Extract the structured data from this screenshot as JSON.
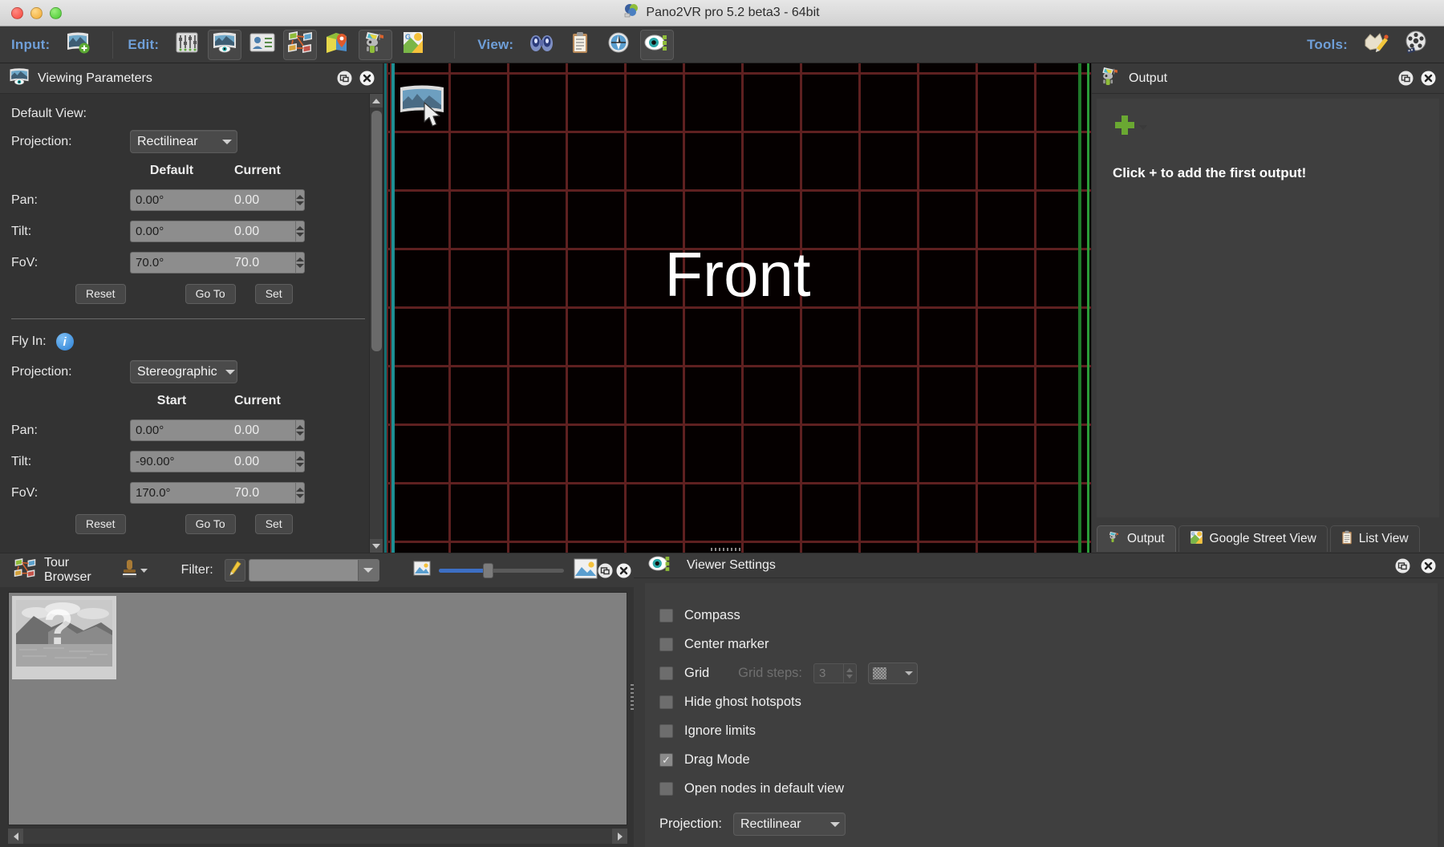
{
  "window": {
    "title": "Pano2VR pro 5.2 beta3 - 64bit",
    "app_icon": "pano2vr-logo-icon",
    "traffic_lights": [
      "close-button",
      "minimize-button",
      "zoom-button"
    ]
  },
  "toolbar": {
    "input_label": "Input:",
    "edit_label": "Edit:",
    "view_label": "View:",
    "tools_label": "Tools:",
    "input_buttons": [
      {
        "name": "add-input-panorama-button",
        "icon": "panorama-plus-icon",
        "active": false
      }
    ],
    "edit_buttons": [
      {
        "name": "edit-sliders-button",
        "icon": "sliders-icon",
        "active": false
      },
      {
        "name": "edit-viewing-parameters-button",
        "icon": "panorama-eye-icon",
        "active": true
      },
      {
        "name": "edit-user-data-button",
        "icon": "id-card-icon",
        "active": false
      },
      {
        "name": "edit-tour-browser-button",
        "icon": "tour-nodes-icon",
        "active": true
      },
      {
        "name": "edit-hotspots-button",
        "icon": "map-pin-icon",
        "active": false
      },
      {
        "name": "edit-output-button",
        "icon": "output-robot-icon",
        "active": true
      },
      {
        "name": "edit-google-street-view-button",
        "icon": "google-maps-icon",
        "active": false
      }
    ],
    "view_buttons": [
      {
        "name": "view-binoculars-button",
        "icon": "binoculars-icon",
        "active": false
      },
      {
        "name": "view-list-button",
        "icon": "clipboard-icon",
        "active": false
      },
      {
        "name": "view-compass-button",
        "icon": "compass-icon",
        "active": false
      },
      {
        "name": "view-viewer-settings-button",
        "icon": "eye-settings-icon",
        "active": true
      }
    ],
    "tools_buttons": [
      {
        "name": "tools-skin-editor-button",
        "icon": "skin-pencil-icon",
        "active": false
      },
      {
        "name": "tools-animation-editor-button",
        "icon": "film-reel-icon",
        "active": false
      }
    ]
  },
  "viewing_parameters": {
    "panel_title": "Viewing Parameters",
    "panel_icon": "panorama-eye-icon",
    "undock_icon": "undock-icon",
    "close_icon": "close-icon",
    "default_view": {
      "section_label": "Default View:",
      "projection_label": "Projection:",
      "projection_value": "Rectilinear",
      "col_value_header": "Default",
      "col_current_header": "Current",
      "rows": [
        {
          "label": "Pan:",
          "value": "0.00°",
          "current": "0.00"
        },
        {
          "label": "Tilt:",
          "value": "0.00°",
          "current": "0.00"
        },
        {
          "label": "FoV:",
          "value": "70.0°",
          "current": "70.0"
        }
      ],
      "reset_label": "Reset",
      "goto_label": "Go To",
      "set_label": "Set"
    },
    "fly_in": {
      "section_label": "Fly In:",
      "info_icon": "info-icon",
      "projection_label": "Projection:",
      "projection_value": "Stereographic",
      "col_value_header": "Start",
      "col_current_header": "Current",
      "rows": [
        {
          "label": "Pan:",
          "value": "0.00°",
          "current": "0.00"
        },
        {
          "label": "Tilt:",
          "value": "-90.00°",
          "current": "0.00"
        },
        {
          "label": "FoV:",
          "value": "170.0°",
          "current": "70.0"
        }
      ],
      "reset_label": "Reset",
      "goto_label": "Go To",
      "set_label": "Set"
    }
  },
  "viewport": {
    "face_label": "Front",
    "grid_color": "#5a1f1f",
    "background_color": "#050000",
    "left_edge_color": "#1e8f93",
    "right_edge_color": "#2a9c39",
    "pano_thumb_icon": "panorama-thumbnail-icon",
    "cursor_icon": "arrow-cursor-icon"
  },
  "output": {
    "panel_title": "Output",
    "panel_icon": "output-robot-icon",
    "undock_icon": "undock-icon",
    "close_icon": "close-icon",
    "add_icon": "green-plus-icon",
    "empty_message": "Click + to add the first output!",
    "tabs": [
      {
        "label": "Output",
        "icon": "output-robot-icon",
        "active": true
      },
      {
        "label": "Google Street View",
        "icon": "google-maps-icon",
        "active": false
      },
      {
        "label": "List View",
        "icon": "clipboard-icon",
        "active": false
      }
    ]
  },
  "tour_browser": {
    "panel_title": "Tour Browser",
    "panel_icon": "tour-nodes-icon",
    "stamp_icon": "stamp-tool-icon",
    "filter_label": "Filter:",
    "filter_pencil_icon": "pencil-icon",
    "filter_value": "",
    "filter_placeholder": "",
    "zoom_small_icon": "small-image-icon",
    "zoom_large_icon": "large-image-icon",
    "zoom_percent": 38,
    "undock_icon": "undock-icon",
    "close_icon": "close-icon",
    "nodes": [
      {
        "name": "node-thumbnail",
        "label": "",
        "placeholder_icon": "question-mark-icon"
      }
    ],
    "scroll_left_icon": "triangle-left-icon",
    "scroll_right_icon": "triangle-right-icon"
  },
  "viewer_settings": {
    "panel_title": "Viewer Settings",
    "panel_icon": "eye-settings-icon",
    "undock_icon": "undock-icon",
    "close_icon": "close-icon",
    "checkboxes": [
      {
        "label": "Compass",
        "checked": false,
        "disabled": false
      },
      {
        "label": "Center marker",
        "checked": false,
        "disabled": false
      },
      {
        "label": "Grid",
        "checked": false,
        "disabled": false
      },
      {
        "label": "Hide ghost hotspots",
        "checked": false,
        "disabled": false
      },
      {
        "label": "Ignore limits",
        "checked": false,
        "disabled": false
      },
      {
        "label": "Drag Mode",
        "checked": true,
        "disabled": false
      },
      {
        "label": "Open nodes in default view",
        "checked": false,
        "disabled": false
      }
    ],
    "grid_steps_label": "Grid steps:",
    "grid_steps_value": "3",
    "grid_style_icon": "checker-swatch-icon",
    "projection_label": "Projection:",
    "projection_value": "Rectilinear"
  }
}
